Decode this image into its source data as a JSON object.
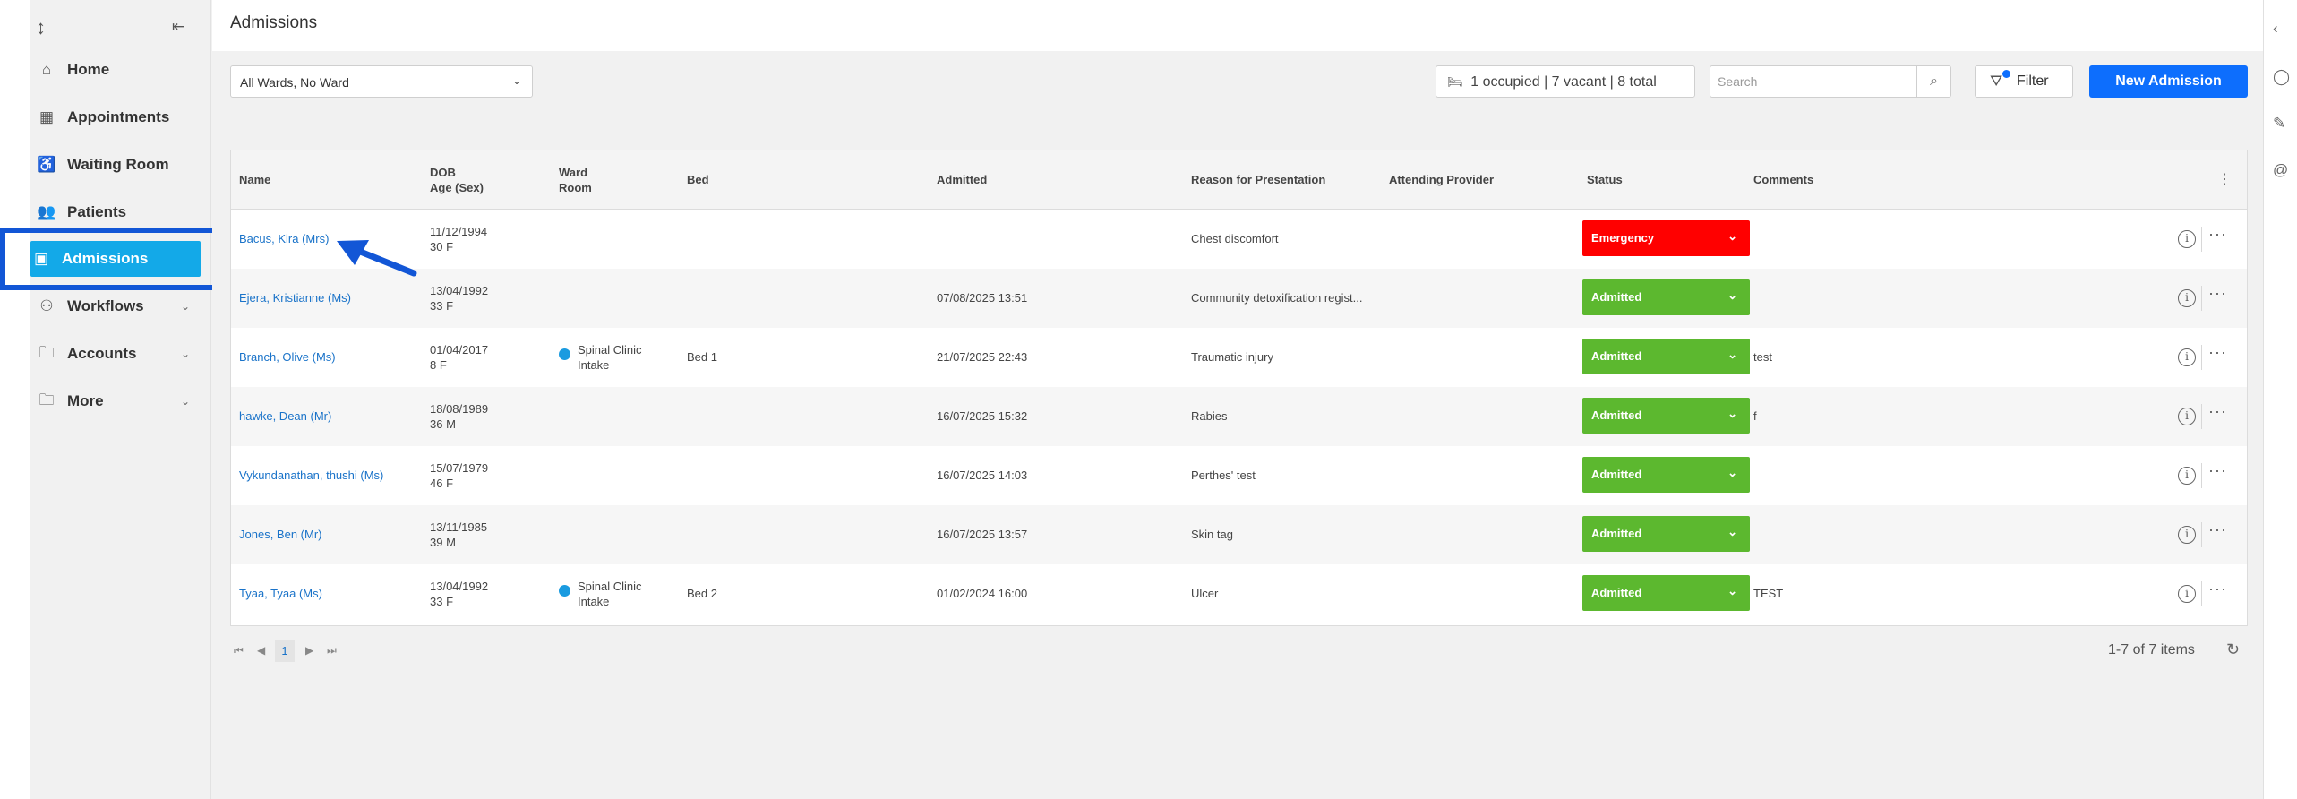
{
  "page": {
    "title": "Admissions"
  },
  "sidebar": {
    "items": [
      {
        "label": "Home",
        "icon": "home-icon"
      },
      {
        "label": "Appointments",
        "icon": "calendar-icon"
      },
      {
        "label": "Waiting Room",
        "icon": "waiting-room-icon"
      },
      {
        "label": "Patients",
        "icon": "patients-icon"
      },
      {
        "label": "Admissions",
        "icon": "admissions-icon",
        "active": true
      },
      {
        "label": "Workflows",
        "icon": "workflows-icon",
        "expandable": true
      },
      {
        "label": "Accounts",
        "icon": "folder-icon",
        "expandable": true
      },
      {
        "label": "More",
        "icon": "more-folder-icon",
        "expandable": true
      }
    ]
  },
  "toolbar": {
    "ward_filter": "All Wards, No Ward",
    "occupancy": "1 occupied | 7 vacant | 8 total",
    "search_placeholder": "Search",
    "filter_label": "Filter",
    "new_admission_label": "New Admission"
  },
  "table": {
    "headers": {
      "name": "Name",
      "dob": "DOB",
      "age_sex": "Age (Sex)",
      "ward": "Ward",
      "room": "Room",
      "bed": "Bed",
      "admitted": "Admitted",
      "reason": "Reason for Presentation",
      "provider": "Attending Provider",
      "status": "Status",
      "comments": "Comments"
    },
    "rows": [
      {
        "name": "Bacus, Kira (Mrs)",
        "dob": "11/12/1994",
        "age": "30 F",
        "ward": "",
        "ward2": "",
        "bed": "",
        "admitted": "",
        "reason": "Chest discomfort",
        "status": "Emergency",
        "comments": ""
      },
      {
        "name": "Ejera, Kristianne (Ms)",
        "dob": "13/04/1992",
        "age": "33 F",
        "ward": "",
        "ward2": "",
        "bed": "",
        "admitted": "07/08/2025 13:51",
        "reason": "Community detoxification regist...",
        "status": "Admitted",
        "comments": ""
      },
      {
        "name": "Branch, Olive (Ms)",
        "dob": "01/04/2017",
        "age": "8 F",
        "ward": "Spinal Clinic",
        "ward2": "Intake",
        "bed": "Bed 1",
        "admitted": "21/07/2025 22:43",
        "reason": "Traumatic injury",
        "status": "Admitted",
        "comments": "test"
      },
      {
        "name": "hawke, Dean (Mr)",
        "dob": "18/08/1989",
        "age": "36 M",
        "ward": "",
        "ward2": "",
        "bed": "",
        "admitted": "16/07/2025 15:32",
        "reason": "Rabies",
        "status": "Admitted",
        "comments": "f"
      },
      {
        "name": "Vykundanathan, thushi (Ms)",
        "dob": "15/07/1979",
        "age": "46 F",
        "ward": "",
        "ward2": "",
        "bed": "",
        "admitted": "16/07/2025 14:03",
        "reason": "Perthes' test",
        "status": "Admitted",
        "comments": ""
      },
      {
        "name": "Jones, Ben (Mr)",
        "dob": "13/11/1985",
        "age": "39 M",
        "ward": "",
        "ward2": "",
        "bed": "",
        "admitted": "16/07/2025 13:57",
        "reason": "Skin tag",
        "status": "Admitted",
        "comments": ""
      },
      {
        "name": "Tyaa, Tyaa (Ms)",
        "dob": "13/04/1992",
        "age": "33 F",
        "ward": "Spinal Clinic",
        "ward2": "Intake",
        "bed": "Bed 2",
        "admitted": "01/02/2024 16:00",
        "reason": "Ulcer",
        "status": "Admitted",
        "comments": "TEST"
      }
    ]
  },
  "pager": {
    "page": "1",
    "items_summary": "1-7 of 7 items"
  },
  "colors": {
    "accent": "#0d6efd",
    "active_nav": "#13a9e8",
    "emergency": "#ff0000",
    "admitted": "#5cb82f",
    "annotation": "#1256d6",
    "ward_dot": "#1a9be0"
  }
}
